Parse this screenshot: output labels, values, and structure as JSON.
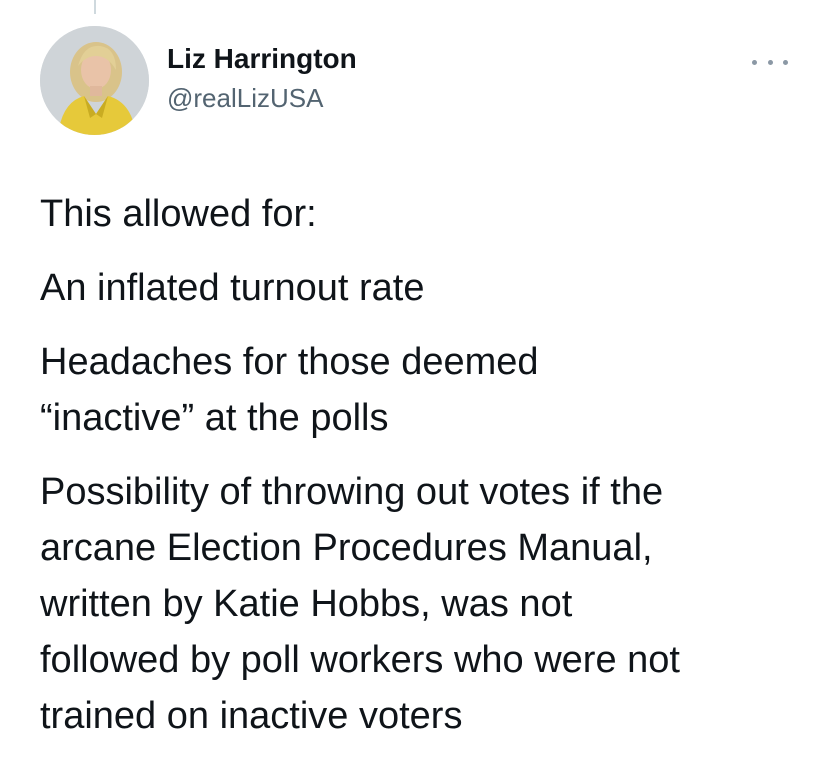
{
  "tweet": {
    "author": {
      "display_name": "Liz Harrington",
      "handle": "@realLizUSA",
      "avatar_icon": "profile-photo"
    },
    "more_icon": "more-options-icon",
    "paragraphs": [
      "This allowed for:",
      "An inflated turnout rate",
      "Headaches for those deemed\n“inactive” at the polls",
      "Possibility of throwing out votes if the\narcane Election Procedures Manual,\nwritten by Katie Hobbs, was not\nfollowed by poll workers who were not\ntrained on inactive voters"
    ]
  },
  "colors": {
    "text": "#0f1419",
    "secondary_text": "#536471",
    "background": "#ffffff",
    "jacket": "#e6c93a"
  }
}
